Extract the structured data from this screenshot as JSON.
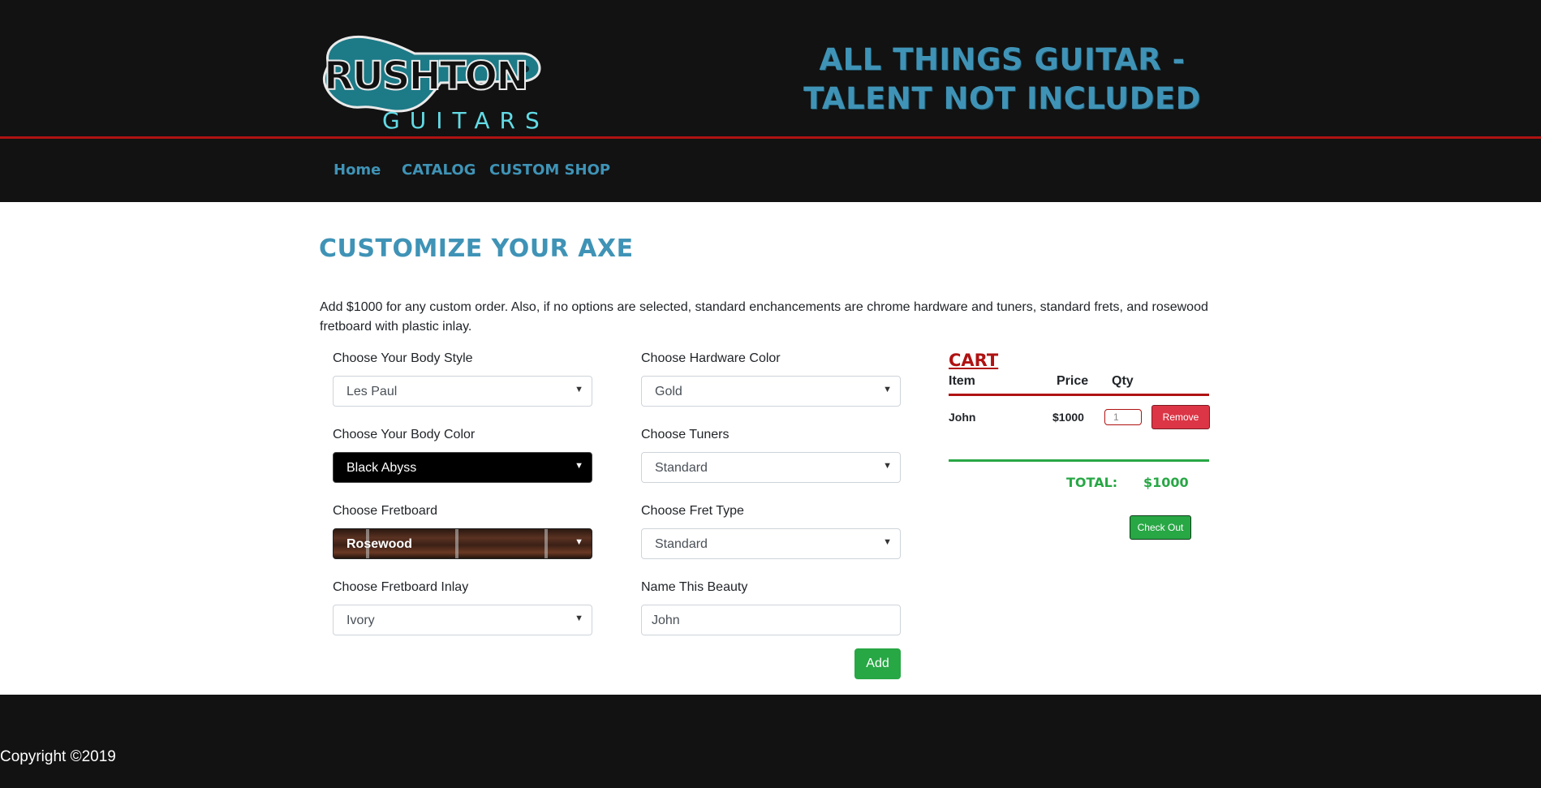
{
  "brand": {
    "logo_top": "RUSHTON",
    "logo_bottom": "GUITARS",
    "tagline": "ALL THINGS GUITAR - TALENT NOT INCLUDED"
  },
  "nav": {
    "items": [
      {
        "label": "Home"
      },
      {
        "label": "CATALOG"
      },
      {
        "label": "CUSTOM SHOP"
      }
    ]
  },
  "page": {
    "title": "Customize Your Axe",
    "intro": "Add $1000 for any custom order. Also, if no options are selected, standard enchancements are chrome hardware and tuners, standard frets, and rosewood fretboard with plastic inlay."
  },
  "form": {
    "body_style": {
      "label": "Choose Your Body Style",
      "value": "Les Paul"
    },
    "body_color": {
      "label": "Choose Your Body Color",
      "value": "Black Abyss"
    },
    "fretboard": {
      "label": "Choose Fretboard",
      "value": "Rosewood"
    },
    "fretboard_inlay": {
      "label": "Choose Fretboard Inlay",
      "value": "Ivory"
    },
    "hardware_color": {
      "label": "Choose Hardware Color",
      "value": "Gold"
    },
    "tuners": {
      "label": "Choose Tuners",
      "value": "Standard"
    },
    "fret_type": {
      "label": "Choose Fret Type",
      "value": "Standard"
    },
    "name": {
      "label": "Name This Beauty",
      "value": "John"
    },
    "add_label": "Add"
  },
  "cart": {
    "title": "CART",
    "columns": {
      "item": "Item",
      "price": "Price",
      "qty": "Qty"
    },
    "items": [
      {
        "item": "John",
        "price": "$1000",
        "qty": "1",
        "remove_label": "Remove"
      }
    ],
    "total_label": "TOTAL:",
    "total_value": "$1000",
    "checkout_label": "Check Out"
  },
  "footer": {
    "copyright": "Copyright ©2019"
  },
  "colors": {
    "header_bg": "#121212",
    "brand_blue": "#3f93b6",
    "accent_red": "#b01212",
    "success_green": "#28a745",
    "danger_red": "#dc3545"
  }
}
